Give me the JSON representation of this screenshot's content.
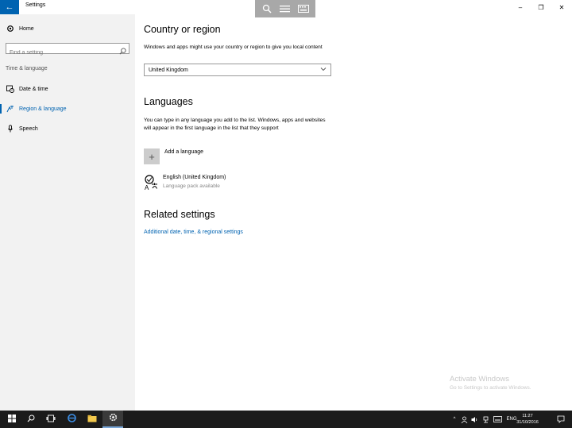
{
  "window": {
    "title": "Settings",
    "controls": {
      "minimize": "–",
      "restore": "❐",
      "close": "✕"
    }
  },
  "viewer_toolbar": [
    "zoom-icon",
    "lines-icon",
    "keyboard-icon"
  ],
  "sidebar": {
    "home_label": "Home",
    "search_placeholder": "Find a setting",
    "section_label": "Time & language",
    "items": [
      {
        "label": "Date & time",
        "icon": "calendar-clock-icon",
        "active": false
      },
      {
        "label": "Region & language",
        "icon": "region-language-icon",
        "active": true
      },
      {
        "label": "Speech",
        "icon": "microphone-icon",
        "active": false
      }
    ]
  },
  "main": {
    "country": {
      "heading": "Country or region",
      "description": "Windows and apps might use your country or region to give you local content",
      "selected": "United Kingdom"
    },
    "languages": {
      "heading": "Languages",
      "description": "You can type in any language you add to the list. Windows, apps and websites will appear in the first language in the list that they support",
      "add_label": "Add a language",
      "installed": [
        {
          "name": "English (United Kingdom)",
          "status": "Language pack available"
        }
      ]
    },
    "related": {
      "heading": "Related settings",
      "link": "Additional date, time, & regional settings"
    }
  },
  "watermark": {
    "title": "Activate Windows",
    "subtitle": "Go to Settings to activate Windows."
  },
  "taskbar": {
    "language": "ENG",
    "time": "11:27",
    "date": "31/10/2016"
  },
  "colors": {
    "accent": "#0063b1",
    "sidebar_bg": "#f2f2f2",
    "taskbar_bg": "#1b1b1b"
  }
}
